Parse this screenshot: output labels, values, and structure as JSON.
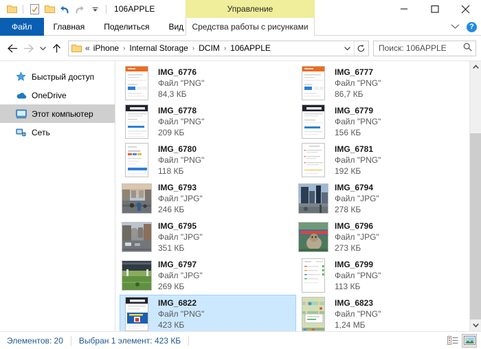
{
  "window": {
    "title": "106APPLE",
    "quick_access": [
      {
        "name": "folder-icon"
      },
      {
        "name": "properties-icon"
      },
      {
        "name": "new-folder-icon"
      },
      {
        "name": "undo-icon"
      },
      {
        "name": "redo-icon"
      },
      {
        "name": "customize-chevron-icon"
      }
    ],
    "caption": {
      "minimize": "minimize-icon",
      "maximize": "maximize-icon",
      "close": "close-icon"
    }
  },
  "ribbon": {
    "contextual_title": "Управление",
    "contextual_subtitle": "Средства работы с рисунками",
    "tabs": [
      {
        "label": "Файл",
        "active": true
      },
      {
        "label": "Главная",
        "active": false
      },
      {
        "label": "Поделиться",
        "active": false
      },
      {
        "label": "Вид",
        "active": false
      }
    ],
    "help_label": "?"
  },
  "address": {
    "back": "back-arrow-icon",
    "forward": "forward-arrow-icon",
    "recent": "recent-locations-icon",
    "up": "up-arrow-icon",
    "double_chevron": "«",
    "crumbs": [
      "iPhone",
      "Internal Storage",
      "DCIM",
      "106APPLE"
    ],
    "separator": "›",
    "dropdown": "chevron-down-icon",
    "refresh": "refresh-icon",
    "search_placeholder": "Поиск: 106APPLE",
    "search_value": ""
  },
  "sidebar": {
    "items": [
      {
        "label": "Быстрый доступ",
        "icon": "star-icon",
        "selected": false
      },
      {
        "label": "OneDrive",
        "icon": "cloud-icon",
        "selected": false
      },
      {
        "label": "Этот компьютер",
        "icon": "computer-icon",
        "selected": true
      },
      {
        "label": "Сеть",
        "icon": "network-icon",
        "selected": false
      }
    ]
  },
  "files": [
    {
      "name": "IMG_6776",
      "type": "Файл \"PNG\"",
      "size": "84,3 КБ",
      "thumb": "screenshot-orange",
      "selected": false
    },
    {
      "name": "IMG_6777",
      "type": "Файл \"PNG\"",
      "size": "86,7 КБ",
      "thumb": "screenshot-orange",
      "selected": false
    },
    {
      "name": "IMG_6778",
      "type": "Файл \"PNG\"",
      "size": "209 КБ",
      "thumb": "screenshot-dark",
      "selected": false
    },
    {
      "name": "IMG_6779",
      "type": "Файл \"PNG\"",
      "size": "156 КБ",
      "thumb": "screenshot-dark",
      "selected": false
    },
    {
      "name": "IMG_6780",
      "type": "Файл \"PNG\"",
      "size": "118 КБ",
      "thumb": "screenshot-light",
      "selected": false
    },
    {
      "name": "IMG_6781",
      "type": "Файл \"PNG\"",
      "size": "192 КБ",
      "thumb": "screenshot-doc",
      "selected": false
    },
    {
      "name": "IMG_6793",
      "type": "Файл \"JPG\"",
      "size": "246 КБ",
      "thumb": "photo-street",
      "selected": false
    },
    {
      "name": "IMG_6794",
      "type": "Файл \"JPG\"",
      "size": "278 КБ",
      "thumb": "photo-city",
      "selected": false
    },
    {
      "name": "IMG_6795",
      "type": "Файл \"JPG\"",
      "size": "351 КБ",
      "thumb": "photo-road",
      "selected": false
    },
    {
      "name": "IMG_6796",
      "type": "Файл \"JPG\"",
      "size": "273 КБ",
      "thumb": "photo-animal",
      "selected": false
    },
    {
      "name": "IMG_6797",
      "type": "Файл \"JPG\"",
      "size": "269 КБ",
      "thumb": "photo-field",
      "selected": false
    },
    {
      "name": "IMG_6799",
      "type": "Файл \"PNG\"",
      "size": "113 КБ",
      "thumb": "screenshot-list",
      "selected": false
    },
    {
      "name": "IMG_6822",
      "type": "Файл \"PNG\"",
      "size": "423 КБ",
      "thumb": "screenshot-blue",
      "selected": true
    },
    {
      "name": "IMG_6823",
      "type": "Файл \"PNG\"",
      "size": "1,24 МБ",
      "thumb": "screenshot-map",
      "selected": false
    }
  ],
  "status": {
    "count_label": "Элементов: 20",
    "selection_label": "Выбран 1 элемент: 423 КБ",
    "views": [
      {
        "name": "details-view-button",
        "active": false
      },
      {
        "name": "large-icons-view-button",
        "active": true
      }
    ]
  },
  "colors": {
    "file_tab": "#0a5fb3",
    "contextual_tab": "#f0ee9a",
    "selection": "#cce8ff",
    "nav_selected": "#cfcfcf",
    "status_text": "#1f5a8f"
  }
}
